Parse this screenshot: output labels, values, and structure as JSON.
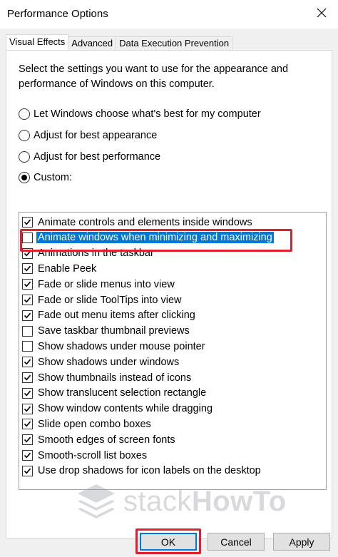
{
  "window": {
    "title": "Performance Options",
    "close_icon": "close-icon"
  },
  "tabs": [
    {
      "label": "Visual Effects",
      "active": true
    },
    {
      "label": "Advanced",
      "active": false
    },
    {
      "label": "Data Execution Prevention",
      "active": false
    }
  ],
  "intro_text": "Select the settings you want to use for the appearance and performance of Windows on this computer.",
  "radios": [
    {
      "label": "Let Windows choose what's best for my computer",
      "checked": false
    },
    {
      "label": "Adjust for best appearance",
      "checked": false
    },
    {
      "label": "Adjust for best performance",
      "checked": false
    },
    {
      "label": "Custom:",
      "checked": true
    }
  ],
  "effects": [
    {
      "label": "Animate controls and elements inside windows",
      "checked": true
    },
    {
      "label": "Animate windows when minimizing and maximizing",
      "checked": false,
      "selected": true
    },
    {
      "label": "Animations in the taskbar",
      "checked": true
    },
    {
      "label": "Enable Peek",
      "checked": true
    },
    {
      "label": "Fade or slide menus into view",
      "checked": true
    },
    {
      "label": "Fade or slide ToolTips into view",
      "checked": true
    },
    {
      "label": "Fade out menu items after clicking",
      "checked": true
    },
    {
      "label": "Save taskbar thumbnail previews",
      "checked": false
    },
    {
      "label": "Show shadows under mouse pointer",
      "checked": false
    },
    {
      "label": "Show shadows under windows",
      "checked": true
    },
    {
      "label": "Show thumbnails instead of icons",
      "checked": true
    },
    {
      "label": "Show translucent selection rectangle",
      "checked": true
    },
    {
      "label": "Show window contents while dragging",
      "checked": true
    },
    {
      "label": "Slide open combo boxes",
      "checked": true
    },
    {
      "label": "Smooth edges of screen fonts",
      "checked": true
    },
    {
      "label": "Smooth-scroll list boxes",
      "checked": true
    },
    {
      "label": "Use drop shadows for icon labels on the desktop",
      "checked": true
    }
  ],
  "watermark": {
    "brand_light": "stack",
    "brand_bold": "HowTo",
    "logo_icon": "stack-layers-icon"
  },
  "buttons": {
    "ok": "OK",
    "cancel": "Cancel",
    "apply": "Apply"
  },
  "colors": {
    "selection": "#0078d7",
    "annotation": "#e0202e",
    "dialog_bg": "#f0f0f0"
  }
}
